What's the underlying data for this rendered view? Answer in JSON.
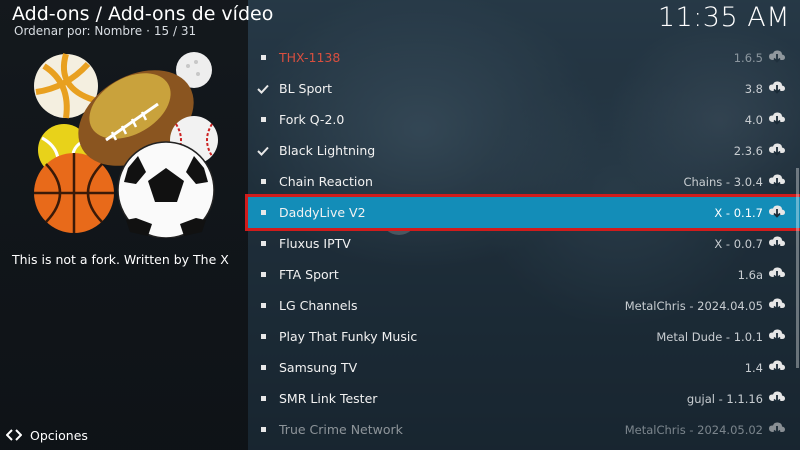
{
  "header": {
    "title": "Add-ons / Add-ons de vídeo",
    "sort_label": "Ordenar por: Nombre",
    "position": "15 / 31",
    "clock": "11:35 AM"
  },
  "addon_art": "sports-balls-icon",
  "description": "This is not a fork. Written by The X",
  "footer": {
    "options_label": "Opciones"
  },
  "colors": {
    "selected": "#138db8",
    "highlight_border": "#d01c1c",
    "broken_name": "#d94f3f"
  },
  "addons": [
    {
      "name": "THX-1138",
      "version": "1.6.5",
      "mark": "bullet",
      "state": "broken"
    },
    {
      "name": "BL Sport",
      "version": "3.8",
      "mark": "check",
      "state": ""
    },
    {
      "name": "Fork Q-2.0",
      "version": "4.0",
      "mark": "bullet",
      "state": ""
    },
    {
      "name": "Black Lightning",
      "version": "2.3.6",
      "mark": "check",
      "state": ""
    },
    {
      "name": "Chain Reaction",
      "version": "Chains - 3.0.4",
      "mark": "bullet",
      "state": ""
    },
    {
      "name": "DaddyLive V2",
      "version": "X - 0.1.7",
      "mark": "bullet",
      "state": "selected"
    },
    {
      "name": "Fluxus IPTV",
      "version": "X - 0.0.7",
      "mark": "bullet",
      "state": ""
    },
    {
      "name": "FTA Sport",
      "version": "1.6a",
      "mark": "bullet",
      "state": ""
    },
    {
      "name": "LG Channels",
      "version": "MetalChris - 2024.04.05",
      "mark": "bullet",
      "state": ""
    },
    {
      "name": "Play That Funky Music",
      "version": "Metal Dude - 1.0.1",
      "mark": "bullet",
      "state": ""
    },
    {
      "name": "Samsung TV",
      "version": "1.4",
      "mark": "bullet",
      "state": ""
    },
    {
      "name": "SMR Link Tester",
      "version": "gujal - 1.1.16",
      "mark": "bullet",
      "state": ""
    },
    {
      "name": "True Crime Network",
      "version": "MetalChris - 2024.05.02",
      "mark": "bullet",
      "state": "dim"
    }
  ]
}
